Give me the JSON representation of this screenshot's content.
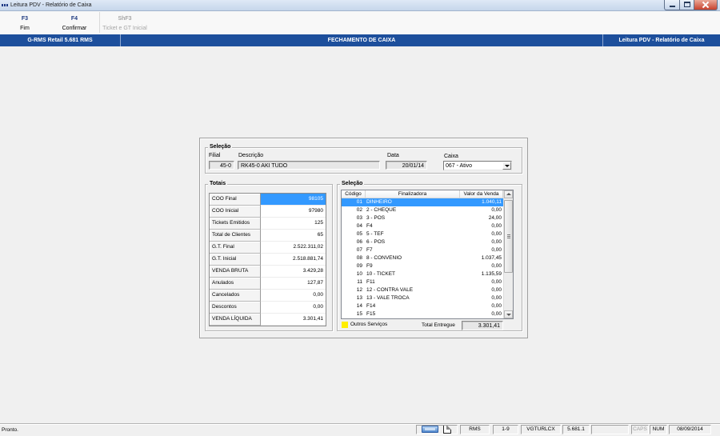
{
  "window": {
    "title": "Leitura PDV - Relatório de Caixa"
  },
  "toolbar": {
    "buttons": [
      {
        "key": "F3",
        "label": "Fim",
        "enabled": true
      },
      {
        "key": "F4",
        "label": "Confirmar",
        "enabled": true
      },
      {
        "key": "ShF3",
        "label": "Ticket e GT Inicial",
        "enabled": false
      }
    ]
  },
  "header": {
    "left": "G-RMS Retail 5.681 RMS",
    "center": "FECHAMENTO DE CAIXA",
    "right": "Leitura PDV - Relatório de Caixa"
  },
  "selecao": {
    "title": "Seleção",
    "filial": {
      "label": "Filial",
      "value": "45-0"
    },
    "descricao": {
      "label": "Descrição",
      "value": "RK45-0 AKI TUDO"
    },
    "data": {
      "label": "Data",
      "value": "20/01/14"
    },
    "caixa": {
      "label": "Caixa",
      "value": "067 - Ativo"
    }
  },
  "totais": {
    "title": "Totais",
    "selected_index": 0,
    "rows": [
      {
        "label": "COO Final",
        "value": "98105"
      },
      {
        "label": "COO Inicial",
        "value": "97980"
      },
      {
        "label": "Tickets Emitidos",
        "value": "125"
      },
      {
        "label": "Total de Clientes",
        "value": "65"
      },
      {
        "label": "G.T. Final",
        "value": "2.522.311,02"
      },
      {
        "label": "G.T. Inicial",
        "value": "2.518.881,74"
      },
      {
        "label": "VENDA BRUTA",
        "value": "3.429,28"
      },
      {
        "label": "Anulados",
        "value": "127,87"
      },
      {
        "label": "Cancelados",
        "value": "0,00"
      },
      {
        "label": "Descontos",
        "value": "0,00"
      },
      {
        "label": "VENDA LÍQUIDA",
        "value": "3.301,41"
      }
    ]
  },
  "finalizadoras": {
    "title": "Seleção",
    "columns": {
      "codigo": "Código",
      "finalizadora": "Finalizadora",
      "valor": "Valor da Venda"
    },
    "selected_index": 0,
    "rows": [
      {
        "code": "01",
        "name": "DINHEIRO",
        "value": "1.040,11"
      },
      {
        "code": "02",
        "name": "2 - CHEQUE",
        "value": "0,00"
      },
      {
        "code": "03",
        "name": "3 - POS",
        "value": "24,00"
      },
      {
        "code": "04",
        "name": "F4",
        "value": "0,00"
      },
      {
        "code": "05",
        "name": "5 - TEF",
        "value": "0,00"
      },
      {
        "code": "06",
        "name": "6 - POS",
        "value": "0,00"
      },
      {
        "code": "07",
        "name": "F7",
        "value": "0,00"
      },
      {
        "code": "08",
        "name": "8 - CONVENIO",
        "value": "1.037,45"
      },
      {
        "code": "09",
        "name": "F9",
        "value": "0,00"
      },
      {
        "code": "10",
        "name": "10 - TICKET",
        "value": "1.135,59"
      },
      {
        "code": "11",
        "name": "F11",
        "value": "0,00"
      },
      {
        "code": "12",
        "name": "12 - CONTRA VALE",
        "value": "0,00"
      },
      {
        "code": "13",
        "name": "13 - VALE TROCA",
        "value": "0,00"
      },
      {
        "code": "14",
        "name": "F14",
        "value": "0,00"
      },
      {
        "code": "15",
        "name": "F15",
        "value": "0,00"
      }
    ]
  },
  "footer": {
    "outros_servicos": "Outros Serviços",
    "total_entregue_label": "Total Entregue",
    "total_entregue_value": "3.301,41"
  },
  "statusbar": {
    "message": "Pronto.",
    "rms": "RMS",
    "range": "1-9",
    "program": "VGTURLCX",
    "version": "5.681.1",
    "caps": "CAPS",
    "num": "NUM",
    "date": "08/09/2014"
  },
  "icons": {
    "app": "app-icon",
    "minimize": "minimize-icon",
    "maximize": "maximize-icon",
    "close": "close-icon",
    "dropdown": "chevron-down-icon",
    "scroll_up": "arrow-up-icon",
    "scroll_down": "arrow-down-icon",
    "terminal": "terminal-icon",
    "document": "document-icon"
  },
  "colors": {
    "header_bg": "#1d4f9c",
    "selection": "#3399ff",
    "outros_servicos_marker": "#ffee00"
  }
}
